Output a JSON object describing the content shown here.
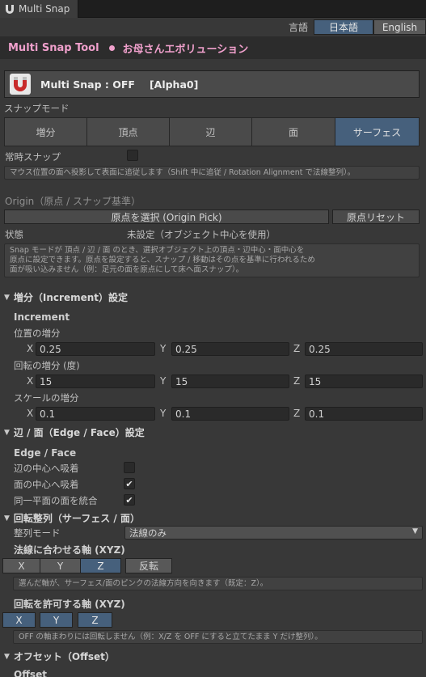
{
  "tab": {
    "title": "Multi Snap"
  },
  "language": {
    "label": "言語",
    "options": [
      "日本語",
      "English"
    ],
    "selected": "日本語"
  },
  "title_bar": {
    "title": "Multi Snap Tool",
    "subtitle": "お母さんエボリューション"
  },
  "header": {
    "status_text": "Multi Snap : OFF",
    "version": "[Alpha0]"
  },
  "snap_mode": {
    "label": "スナップモード",
    "modes": [
      "増分",
      "頂点",
      "辺",
      "面",
      "サーフェス"
    ],
    "selected": "サーフェス",
    "always_snap_label": "常時スナップ",
    "always_snap_checked": false,
    "help": "マウス位置の面へ投影して表面に追従します（Shift 中に追従 / Rotation Alignment で法線整列）。"
  },
  "origin": {
    "title": "Origin（原点 / スナップ基準）",
    "pick_button": "原点を選択 (Origin Pick)",
    "reset_button": "原点リセット",
    "status_label": "状態",
    "status_value": "未設定（オブジェクト中心を使用）",
    "help_lines": [
      "Snap モードが 頂点 / 辺 / 面 のとき、選択オブジェクト上の頂点・辺中心・面中心を",
      "原点に設定できます。原点を設定すると、スナップ / 移動はその点を基準に行われるため",
      "面が吸い込みません（例：足元の面を原点にして床へ面スナップ）。"
    ]
  },
  "increment": {
    "foldout_title": "増分（Increment）設定",
    "sub_title": "Increment",
    "position_label": "位置の増分",
    "rotation_label": "回転の増分 (度)",
    "scale_label": "スケールの増分",
    "axes": [
      "X",
      "Y",
      "Z"
    ],
    "position": [
      "0.25",
      "0.25",
      "0.25"
    ],
    "rotation": [
      "15",
      "15",
      "15"
    ],
    "scale": [
      "0.1",
      "0.1",
      "0.1"
    ]
  },
  "edge_face": {
    "foldout_title": "辺 / 面（Edge / Face）設定",
    "sub_title": "Edge / Face",
    "options": [
      {
        "label": "辺の中心へ吸着",
        "checked": false
      },
      {
        "label": "面の中心へ吸着",
        "checked": true
      },
      {
        "label": "同一平面の面を統合",
        "checked": true
      }
    ]
  },
  "rotation_alignment": {
    "foldout_title": "回転整列（サーフェス / 面）",
    "mode_label": "整列モード",
    "mode_value": "法線のみ",
    "normal_axis_title": "法線に合わせる軸 (XYZ)",
    "normal_axis_buttons": [
      "X",
      "Y",
      "Z"
    ],
    "normal_axis_selected": "Z",
    "flip_button": "反転",
    "normal_axis_help": "選んだ軸が、サーフェス/面のピンクの法線方向を向きます（既定：Z）。",
    "allowed_axis_title": "回転を許可する軸 (XYZ)",
    "allowed_axis_buttons": [
      "X",
      "Y",
      "Z"
    ],
    "allowed_axis_selected": [
      "X",
      "Y",
      "Z"
    ],
    "allowed_axis_help": "OFF の軸まわりには回転しません（例：X/Z を OFF にすると立てたまま Y だけ整列）。"
  },
  "offset": {
    "foldout_title": "オフセット（Offset）",
    "sub_title": "Offset"
  },
  "colors": {
    "accent_blue": "#46607c",
    "title_pink": "#f0a0cc",
    "magnet_red": "#c82a2a"
  }
}
